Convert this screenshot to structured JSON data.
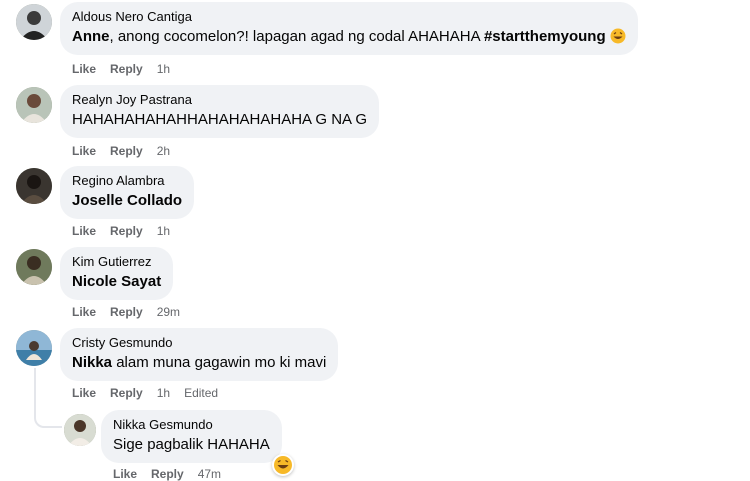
{
  "comments": [
    {
      "name": "Aldous Nero Cantiga",
      "mention": "Anne",
      "text": ", anong cocomelon?! lapagan agad ng codal AHAHAHA ",
      "hashtag": "#startthemyoung",
      "like": "Like",
      "reply": "Reply",
      "time": "1h",
      "emoji": "laughing-face-emoji"
    },
    {
      "name": "Realyn Joy Pastrana",
      "text": "HAHAHAHAHAHHAHAHAHAHAHA G NA G",
      "like": "Like",
      "reply": "Reply",
      "time": "2h"
    },
    {
      "name": "Regino Alambra",
      "mention": "Joselle Collado",
      "like": "Like",
      "reply": "Reply",
      "time": "1h"
    },
    {
      "name": "Kim Gutierrez",
      "mention": "Nicole Sayat",
      "like": "Like",
      "reply": "Reply",
      "time": "29m"
    },
    {
      "name": "Cristy Gesmundo",
      "mention": "Nikka",
      "text": " alam muna gagawin mo ki mavi",
      "like": "Like",
      "reply": "Reply",
      "time": "1h",
      "edited": "Edited"
    },
    {
      "name": "Nikka Gesmundo",
      "text": "Sige pagbalik HAHAHA",
      "like": "Like",
      "reply": "Reply",
      "time": "47m",
      "reaction": "haha-reaction-icon"
    }
  ],
  "colors": {
    "bubble": "#f0f2f5",
    "meta": "#65676b",
    "text": "#050505",
    "reaction": "#f7b928"
  }
}
